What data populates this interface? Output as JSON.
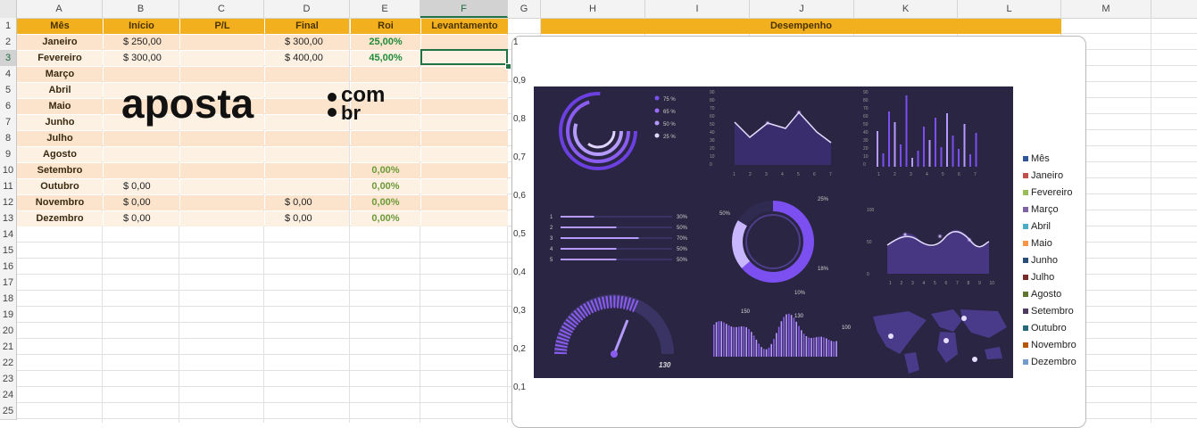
{
  "columns": [
    "A",
    "B",
    "C",
    "D",
    "E",
    "F",
    "G",
    "H",
    "I",
    "J",
    "K",
    "L",
    "M"
  ],
  "selected_column": "F",
  "rows": [
    "1",
    "2",
    "3",
    "4",
    "5",
    "6",
    "7",
    "8",
    "9",
    "10",
    "11",
    "12",
    "13",
    "14",
    "15",
    "16",
    "17",
    "18",
    "19",
    "20",
    "21",
    "22",
    "23",
    "24",
    "25"
  ],
  "selected_row": "3",
  "table": {
    "headers": [
      "Mês",
      "Início",
      "P/L",
      "Final",
      "Roi",
      "Levantamento"
    ],
    "rows": [
      {
        "month": "Janeiro",
        "inicio": "$ 250,00",
        "pl": "",
        "final": "$ 300,00",
        "roi": "25,00%",
        "lev": ""
      },
      {
        "month": "Fevereiro",
        "inicio": "$ 300,00",
        "pl": "",
        "final": "$ 400,00",
        "roi": "45,00%",
        "lev": ""
      },
      {
        "month": "Março",
        "inicio": "",
        "pl": "",
        "final": "",
        "roi": "",
        "lev": ""
      },
      {
        "month": "Abril",
        "inicio": "",
        "pl": "",
        "final": "",
        "roi": "",
        "lev": ""
      },
      {
        "month": "Maio",
        "inicio": "",
        "pl": "",
        "final": "",
        "roi": "",
        "lev": ""
      },
      {
        "month": "Junho",
        "inicio": "",
        "pl": "",
        "final": "",
        "roi": "",
        "lev": ""
      },
      {
        "month": "Julho",
        "inicio": "",
        "pl": "",
        "final": "",
        "roi": "",
        "lev": ""
      },
      {
        "month": "Agosto",
        "inicio": "",
        "pl": "",
        "final": "",
        "roi": "",
        "lev": ""
      },
      {
        "month": "Setembro",
        "inicio": "",
        "pl": "",
        "final": "",
        "roi": "0,00%",
        "lev": ""
      },
      {
        "month": "Outubro",
        "inicio": "$ 0,00",
        "pl": "",
        "final": "",
        "roi": "0,00%",
        "lev": ""
      },
      {
        "month": "Novembro",
        "inicio": "$ 0,00",
        "pl": "",
        "final": "$ 0,00",
        "roi": "0,00%",
        "lev": ""
      },
      {
        "month": "Dezembro",
        "inicio": "$ 0,00",
        "pl": "",
        "final": "$ 0,00",
        "roi": "0,00%",
        "lev": ""
      }
    ]
  },
  "logo": {
    "main": "aposta",
    "com": "com",
    "br": "br"
  },
  "desempenho_header": "Desempenho",
  "chart": {
    "y_ticks": [
      "1",
      "0,9",
      "0,8",
      "0,7",
      "0,6",
      "0,5",
      "0,4",
      "0,3",
      "0,2",
      "0,1"
    ],
    "legend": [
      {
        "label": "Mês",
        "color": "#2f5597"
      },
      {
        "label": "Janeiro",
        "color": "#c0504d"
      },
      {
        "label": "Fevereiro",
        "color": "#9bbb59"
      },
      {
        "label": "Março",
        "color": "#8064a2"
      },
      {
        "label": "Abril",
        "color": "#4bacc6"
      },
      {
        "label": "Maio",
        "color": "#f79646"
      },
      {
        "label": "Junho",
        "color": "#2c4d75"
      },
      {
        "label": "Julho",
        "color": "#772c2a"
      },
      {
        "label": "Agosto",
        "color": "#5f7530"
      },
      {
        "label": "Setembro",
        "color": "#4d3b62"
      },
      {
        "label": "Outubro",
        "color": "#276a7c"
      },
      {
        "label": "Novembro",
        "color": "#b65708"
      },
      {
        "label": "Dezembro",
        "color": "#729aca"
      }
    ]
  },
  "dashboard_image": {
    "ring_legend": [
      "75 %",
      "65 %",
      "50 %",
      "25 %"
    ],
    "bar_list": [
      {
        "n": "1",
        "pct": "30%",
        "v": 0.3
      },
      {
        "n": "2",
        "pct": "50%",
        "v": 0.5
      },
      {
        "n": "3",
        "pct": "70%",
        "v": 0.7
      },
      {
        "n": "4",
        "pct": "50%",
        "v": 0.5
      },
      {
        "n": "5",
        "pct": "50%",
        "v": 0.5
      }
    ],
    "donut_labels": [
      "50%",
      "25%",
      "18%",
      "10%"
    ],
    "gauge_value": "130",
    "wave_labels": [
      "150",
      "130",
      "100"
    ],
    "line_y_ticks": [
      "90",
      "80",
      "70",
      "60",
      "50",
      "40",
      "30",
      "20",
      "10",
      "0"
    ],
    "line_x_ticks": [
      "1",
      "2",
      "3",
      "4",
      "5",
      "6",
      "7"
    ],
    "bars_y_ticks": [
      "90",
      "80",
      "70",
      "60",
      "50",
      "40",
      "30",
      "20",
      "10",
      "0"
    ],
    "bars_x_ticks": [
      "1",
      "2",
      "3",
      "4",
      "5",
      "6",
      "7"
    ],
    "area_y_ticks": [
      "100",
      "50",
      "0"
    ],
    "area_x_ticks": [
      "1",
      "2",
      "3",
      "4",
      "5",
      "6",
      "7",
      "8",
      "9",
      "10"
    ]
  }
}
